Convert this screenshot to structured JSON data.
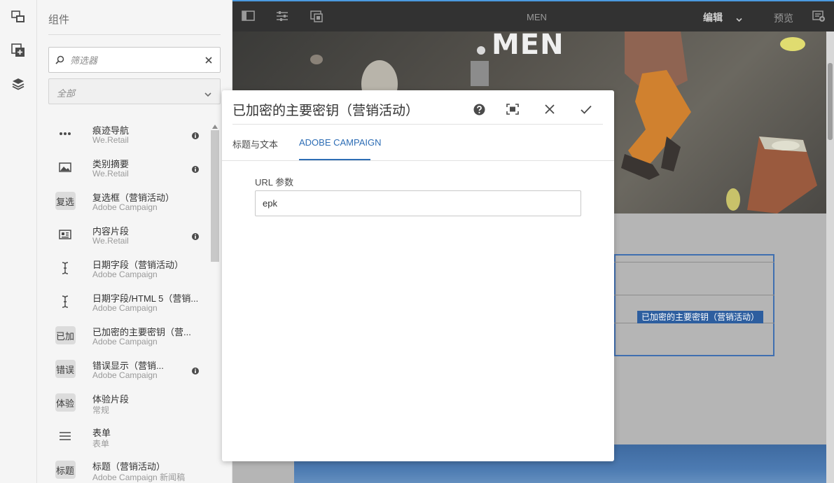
{
  "topbar": {
    "page_title": "MEN",
    "mode_label": "编辑",
    "preview_label": "预览"
  },
  "panel": {
    "title": "组件",
    "filter_placeholder": "筛选器",
    "group_select_value": "全部",
    "components": [
      {
        "name": "痕迹导航",
        "group": "We.Retail",
        "icon": "more-dots-icon",
        "info": true
      },
      {
        "name": "类别摘要",
        "group": "We.Retail",
        "icon": "image-icon",
        "info": true
      },
      {
        "name": "复选框（营销活动）",
        "group": "Adobe Campaign",
        "badge": "复选",
        "info": false
      },
      {
        "name": "内容片段",
        "group": "We.Retail",
        "icon": "content-fragment-icon",
        "info": true
      },
      {
        "name": "日期字段（营销活动）",
        "group": "Adobe Campaign",
        "icon": "text-cursor-icon",
        "info": false
      },
      {
        "name": "日期字段/HTML 5（营销...",
        "group": "Adobe Campaign",
        "icon": "text-cursor-icon",
        "info": false
      },
      {
        "name": "已加密的主要密钥（营...",
        "group": "Adobe Campaign",
        "badge": "已加",
        "info": false
      },
      {
        "name": "错误显示（营销...",
        "group": "Adobe Campaign",
        "badge": "错误",
        "info": true
      },
      {
        "name": "体验片段",
        "group": "常规",
        "badge": "体验",
        "info": false
      },
      {
        "name": "表单",
        "group": "表单",
        "icon": "form-icon",
        "info": false
      },
      {
        "name": "标题（营销活动）",
        "group": "Adobe Campaign 新闻稿",
        "badge": "标题",
        "info": false
      }
    ]
  },
  "canvas": {
    "hero_title": "MEN",
    "selected_component_label": "已加密的主要密钥（营销活动）"
  },
  "dialog": {
    "title": "已加密的主要密钥（营销活动）",
    "tabs": [
      "标题与文本",
      "ADOBE CAMPAIGN"
    ],
    "active_tab": "ADOBE CAMPAIGN",
    "field_label": "URL 参数",
    "field_value": "epk"
  },
  "colors": {
    "accent": "#2d6db5",
    "topbar": "#323232",
    "selection": "#2d5e9f"
  }
}
